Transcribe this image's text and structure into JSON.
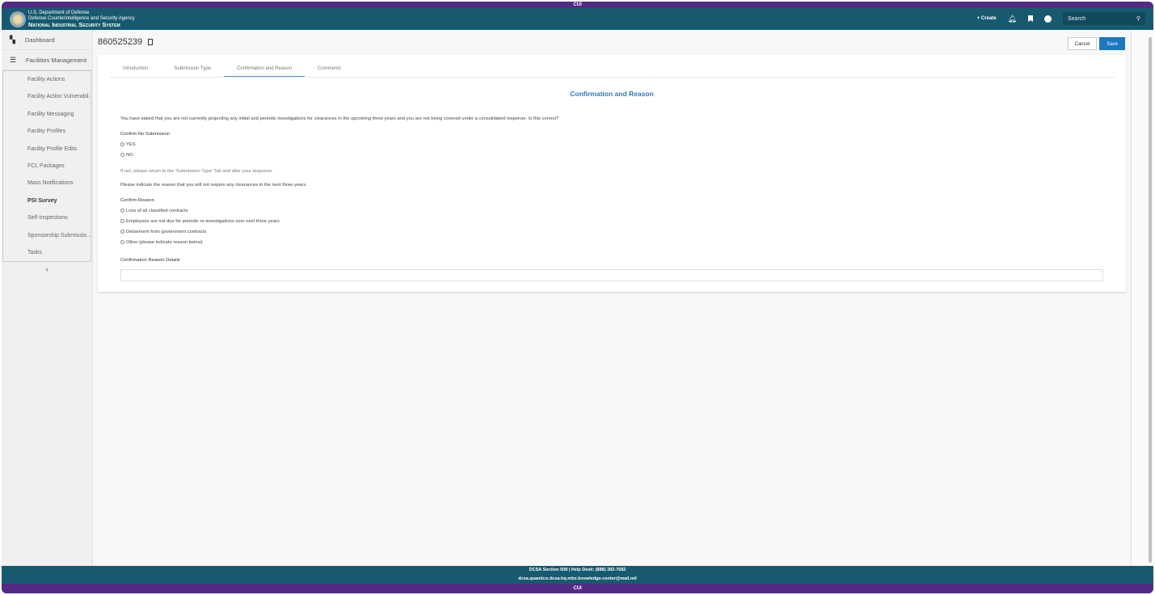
{
  "banner": "CUI",
  "header": {
    "line1": "U.S. Department of Defense",
    "line2": "Defense Counterintelligence and Security Agency",
    "line3": "National Industrial Security System",
    "create": "+ Create",
    "search_placeholder": "Search"
  },
  "sidebar": {
    "dashboard": "Dashboard",
    "facilities": "Facilities Management",
    "items": [
      "Facility Actions",
      "Facility Action Vulnerabil...",
      "Facility Messaging",
      "Facility Profiles",
      "Facility Profile Edits",
      "FCL Packages",
      "Mass Notifications",
      "PSI Survey",
      "Self-Inspections",
      "Sponsorship Submissio...",
      "Tasks"
    ],
    "active": "PSI Survey",
    "collapse": "‹"
  },
  "page": {
    "record": "860525239",
    "cancel": "Cancel",
    "save": "Save"
  },
  "tabs": [
    "Introduction",
    "Submission Type",
    "Confirmation and Reason",
    "Comments"
  ],
  "form": {
    "title": "Confirmation and Reason",
    "question": "You have stated that you are not currently projecting any initial and periodic investigations for clearances in the upcoming three years and you are not being covered under a consolidated response. Is this correct?",
    "confirm_label": "Confirm No Submission",
    "yes": "YES",
    "no": "NO",
    "hint": "If not, please return to the 'Submission Type' Tab and alter your response.",
    "indicate": "Please indicate the reason that you will not require any clearances in the next three years.",
    "reason_label": "Confirm Reason",
    "reasons": [
      "Loss of all classified contracts",
      "Employees are not due for periodic re-investigations over next three years",
      "Debarment from government contracts",
      "Other (please indicate reason below)"
    ],
    "details_label": "Confirmation Reason Details"
  },
  "footer": {
    "line1": "DCSA Section 508 | Help Desk: (888) 282-7682",
    "line2": "dcsa.quantico.dcsa-hq.mbx.knowledge-center@mail.mil"
  },
  "colors": {
    "header": "#175a70",
    "banner": "#532a84",
    "accent": "#1a77c0"
  }
}
